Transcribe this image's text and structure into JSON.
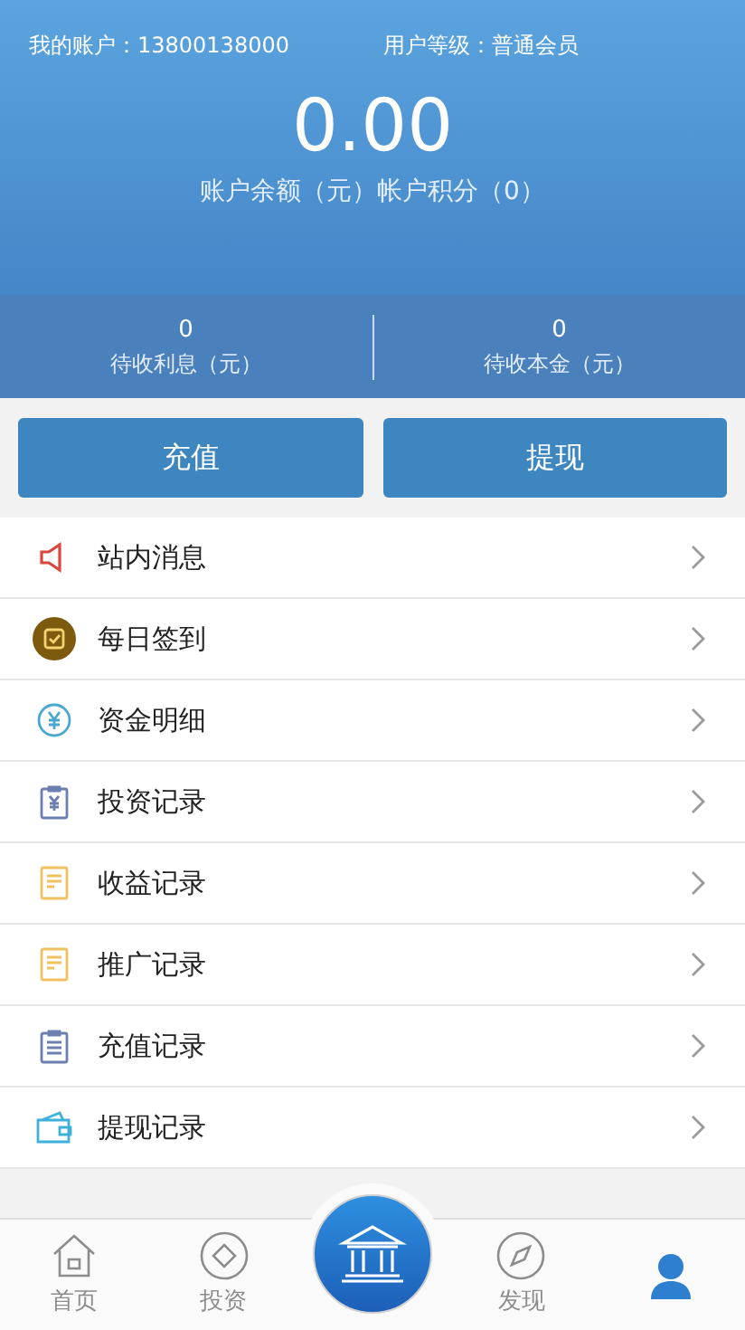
{
  "header": {
    "account_label": "我的账户：13800138000",
    "level_label": "用户等级：普通会员",
    "balance": "0.00",
    "balance_caption": "账户余额（元）帐户积分（0）"
  },
  "stats": [
    {
      "value": "0",
      "label": "待收利息（元）"
    },
    {
      "value": "0",
      "label": "待收本金（元）"
    }
  ],
  "actions": [
    "充值",
    "提现"
  ],
  "menu": [
    {
      "label": "站内消息",
      "kind": "speaker"
    },
    {
      "label": "每日签到",
      "kind": "checkin"
    },
    {
      "label": "资金明细",
      "kind": "yen"
    },
    {
      "label": "投资记录",
      "kind": "clipboardyen"
    },
    {
      "label": "收益记录",
      "kind": "note"
    },
    {
      "label": "推广记录",
      "kind": "note"
    },
    {
      "label": "充值记录",
      "kind": "clipboard"
    },
    {
      "label": "提现记录",
      "kind": "wallet"
    }
  ],
  "bottom_nav": [
    {
      "label": "首页",
      "kind": "home",
      "selected": false
    },
    {
      "label": "投资",
      "kind": "diamond",
      "selected": false
    },
    {
      "kind": "center"
    },
    {
      "label": "发现",
      "kind": "compass",
      "selected": false
    },
    {
      "kind": "person",
      "selected": true
    }
  ]
}
